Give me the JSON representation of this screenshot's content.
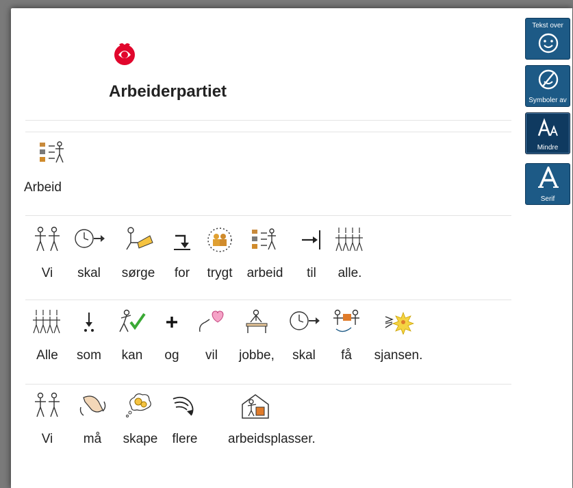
{
  "header": {
    "title": "Arbeiderpartiet",
    "logo_icon": "rose-logo-icon",
    "accent": "#e1062c"
  },
  "heading_block": {
    "label": "Arbeid"
  },
  "sentences": [
    {
      "words": [
        "Vi",
        "skal",
        "sørge",
        "for",
        "trygt",
        "arbeid",
        "til",
        "alle."
      ]
    },
    {
      "words": [
        "Alle",
        "som",
        "kan",
        "og",
        "vil",
        "jobbe,",
        "skal",
        "få",
        "sjansen."
      ]
    },
    {
      "words": [
        "Vi",
        "må",
        "skape",
        "flere",
        "arbeidsplasser."
      ]
    }
  ],
  "sidebar": {
    "buttons": [
      {
        "label": "Tekst over",
        "icon": "smiley-icon"
      },
      {
        "label": "Symboler av",
        "icon": "smiley-off-icon"
      },
      {
        "label": "Mindre",
        "icon": "text-size-icon"
      },
      {
        "label": "Serif",
        "icon": "serif-font-icon"
      }
    ],
    "color": "#1d5a86"
  }
}
